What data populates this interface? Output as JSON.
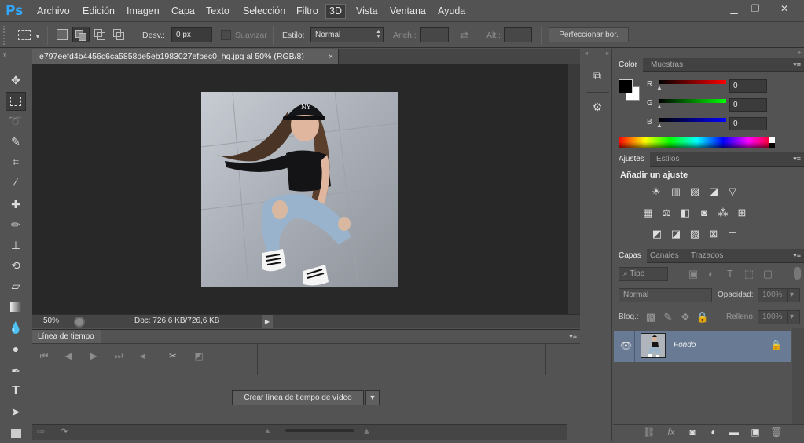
{
  "app": {
    "logo": "Ps"
  },
  "menu": [
    "Archivo",
    "Edición",
    "Imagen",
    "Capa",
    "Texto",
    "Selección",
    "Filtro",
    "3D",
    "Vista",
    "Ventana",
    "Ayuda"
  ],
  "window_controls": {
    "minimize": "▁",
    "restore": "❐",
    "close": "✕"
  },
  "options": {
    "feather_label": "Desv.:",
    "feather_value": "0 px",
    "antialias_label": "Suavizar",
    "style_label": "Estilo:",
    "style_value": "Normal",
    "width_label": "Anch.:",
    "height_label": "Alt.:",
    "refine_button": "Perfeccionar bor."
  },
  "document": {
    "tab_title": "e797eefd4b4456c6ca5858de5eb1983027efbec0_hq.jpg al 50% (RGB/8)",
    "tab_close": "×",
    "zoom": "50%",
    "doc_info": "Doc: 726,6 KB/726,6 KB"
  },
  "timeline": {
    "tab_label": "Línea de tiempo",
    "create_button": "Crear línea de tiempo de vídeo"
  },
  "color_panel": {
    "tabs": [
      "Color",
      "Muestras"
    ],
    "channels": [
      {
        "label": "R",
        "value": "0"
      },
      {
        "label": "G",
        "value": "0"
      },
      {
        "label": "B",
        "value": "0"
      }
    ],
    "foreground": "#000000",
    "background": "#ffffff"
  },
  "adjustments_panel": {
    "tabs": [
      "Ajustes",
      "Estilos"
    ],
    "heading": "Añadir un ajuste"
  },
  "layers_panel": {
    "tabs": [
      "Capas",
      "Canales",
      "Trazados"
    ],
    "filter_label": "Tipo",
    "blend_mode": "Normal",
    "opacity_label": "Opacidad:",
    "opacity_value": "100%",
    "lock_label": "Bloq.:",
    "fill_label": "Relleno:",
    "fill_value": "100%",
    "layers": [
      {
        "name": "Fondo",
        "visible": true,
        "locked": true
      }
    ]
  }
}
